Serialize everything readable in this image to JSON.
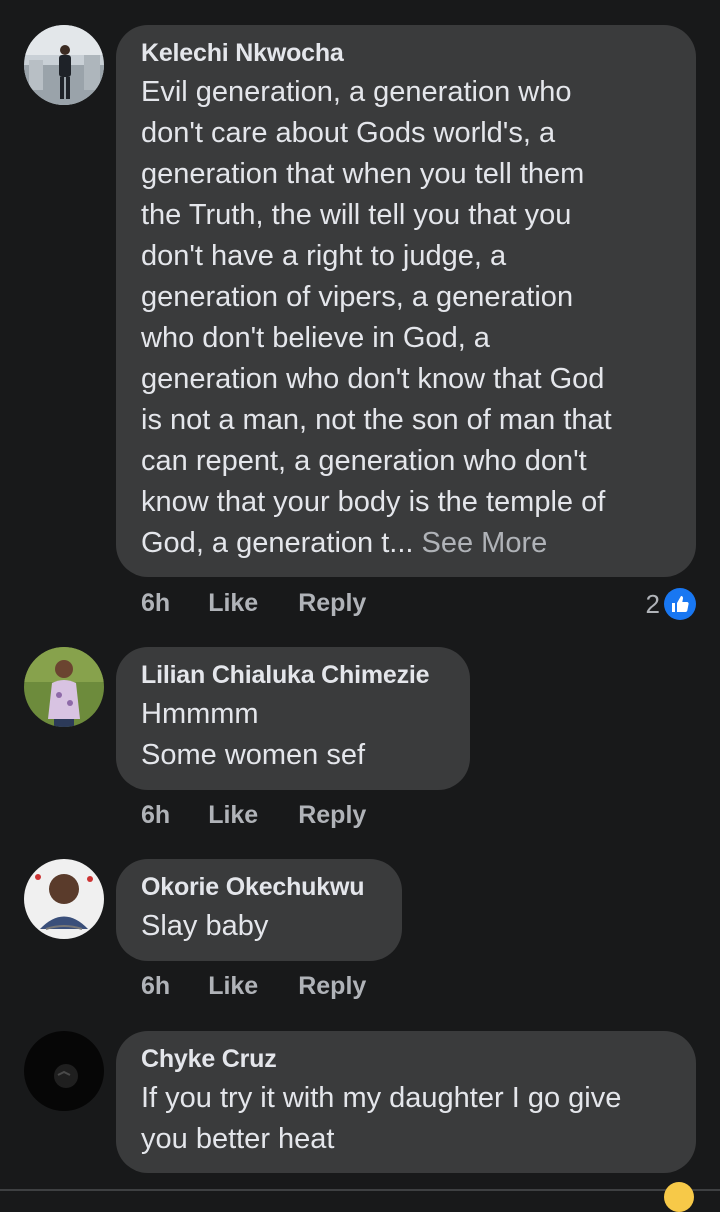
{
  "comments": [
    {
      "author": "Kelechi Nkwocha",
      "text": "Evil generation, a generation who\ndon't care about Gods world's, a\ngeneration that when you tell them\nthe Truth, the will tell you that you\ndon't have a right to judge, a\ngeneration of vipers, a generation\nwho don't believe in God, a\ngeneration who don't know that God\nis not a man, not the son of man that\ncan repent, a generation who don't\nknow that your body is the temple of\nGod, a  generation t...",
      "see_more": " See More",
      "time": "6h",
      "like_label": "Like",
      "reply_label": "Reply",
      "reaction_count": "2",
      "reaction_icon": "thumbs-up-icon",
      "avatar_colors": [
        "#cfd6dc",
        "#2b2f36"
      ]
    },
    {
      "author": "Lilian Chialuka Chimezie",
      "text": "Hmmmm\nSome women sef",
      "time": "6h",
      "like_label": "Like",
      "reply_label": "Reply",
      "avatar_colors": [
        "#6b8f3a",
        "#d9c2e0"
      ]
    },
    {
      "author": "Okorie Okechukwu",
      "text": "Slay baby",
      "time": "6h",
      "like_label": "Like",
      "reply_label": "Reply",
      "avatar_colors": [
        "#f2f2f2",
        "#5a3b2b"
      ]
    },
    {
      "author": "Chyke Cruz",
      "text": "If you try it with my daughter I go give\nyou better heat",
      "avatar_colors": [
        "#050505",
        "#2a2a2a"
      ]
    }
  ],
  "colors": {
    "background": "#18191a",
    "bubble": "#3a3b3c",
    "primary_text": "#e4e6eb",
    "secondary_text": "#b0b3b8",
    "like_blue": "#1877f2"
  }
}
